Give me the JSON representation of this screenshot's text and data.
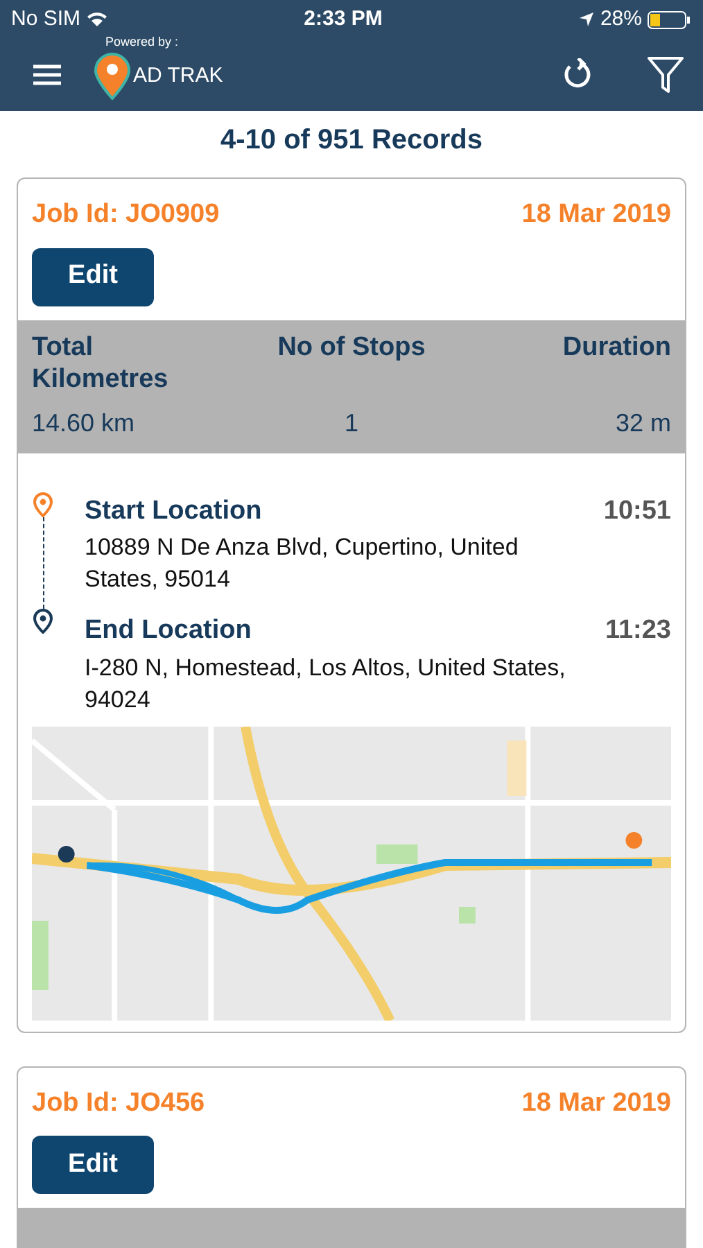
{
  "status_bar": {
    "carrier": "No SIM",
    "time": "2:33 PM",
    "battery": "28%"
  },
  "header": {
    "powered_by": "Powered by :",
    "brand": "AD TRAK"
  },
  "records_title": "4-10 of 951 Records",
  "jobs": [
    {
      "job_id": "Job Id: JO0909",
      "date": "18 Mar 2019",
      "edit_label": "Edit",
      "stats": [
        {
          "label": "Total Kilometres",
          "value": "14.60 km"
        },
        {
          "label": "No of Stops",
          "value": "1"
        },
        {
          "label": "Duration",
          "value": "32 m"
        }
      ],
      "stops": [
        {
          "kind": "start",
          "title": "Start Location",
          "time": "10:51",
          "address": "10889 N De Anza Blvd, Cupertino, United States, 95014"
        },
        {
          "kind": "end",
          "title": "End Location",
          "time": "11:23",
          "address": "I-280 N, Homestead, Los Altos, United States, 94024"
        }
      ],
      "map": {
        "kind": "picture"
      }
    },
    {
      "job_id": "Job Id: JO456",
      "date": "18 Mar 2019",
      "edit_label": "Edit"
    }
  ]
}
